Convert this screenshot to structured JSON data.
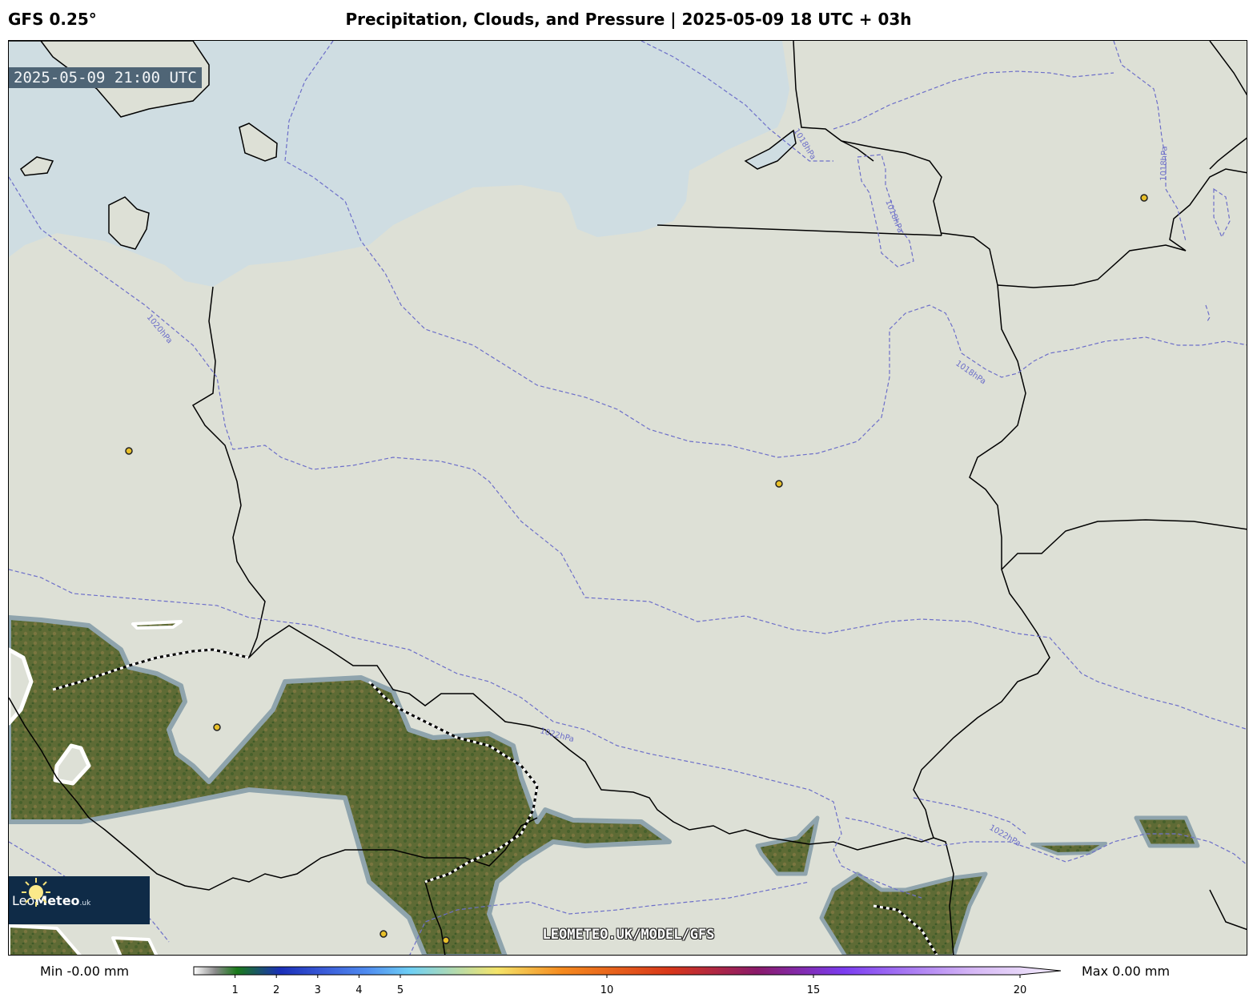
{
  "header": {
    "model": "GFS 0.25°",
    "title": "Precipitation, Clouds, and Pressure | 2025-05-09 18 UTC + 03h"
  },
  "map": {
    "valid_time": "2025-05-09 21:00 UTC",
    "isobar_labels": [
      "1018hPa",
      "1018hPa",
      "1018hPa",
      "1018hPa",
      "1020hPa",
      "1022hPa",
      "1022hPa"
    ],
    "logo": {
      "light": "Leo",
      "bold": "Meteo",
      "suffix": ".uk"
    },
    "watermark": "LEOMETEO.UK/MODEL/GFS",
    "colors": {
      "sea": "#cfdde2",
      "cloud_cover": "#dde0d6",
      "land_clear": "#5e6b35",
      "border": "#000000",
      "isobar": "#6d6fc9",
      "city_marker": "#e8c02a"
    }
  },
  "legend": {
    "min_label": "Min -0.00 mm",
    "max_label": "Max 0.00 mm",
    "ticks": [
      "1",
      "2",
      "3",
      "4",
      "5",
      "10",
      "15",
      "20"
    ],
    "tick_values": [
      1,
      2,
      3,
      4,
      5,
      10,
      15,
      20
    ],
    "range": [
      0,
      20
    ],
    "stops": [
      {
        "v": 0,
        "c": "#ffffff"
      },
      {
        "v": 0.5,
        "c": "#8a8a8a"
      },
      {
        "v": 1,
        "c": "#1a7a1a"
      },
      {
        "v": 2,
        "c": "#1a2fb8"
      },
      {
        "v": 3,
        "c": "#3a5bd8"
      },
      {
        "v": 4,
        "c": "#4f8cf0"
      },
      {
        "v": 5,
        "c": "#6fd0f5"
      },
      {
        "v": 7,
        "c": "#f4e46a"
      },
      {
        "v": 8.5,
        "c": "#f58a1e"
      },
      {
        "v": 11,
        "c": "#d8361a"
      },
      {
        "v": 13,
        "c": "#8a1a6a"
      },
      {
        "v": 15,
        "c": "#7b3cf0"
      },
      {
        "v": 18,
        "c": "#d6b8f5"
      },
      {
        "v": 20,
        "c": "#f4eefb"
      }
    ]
  }
}
